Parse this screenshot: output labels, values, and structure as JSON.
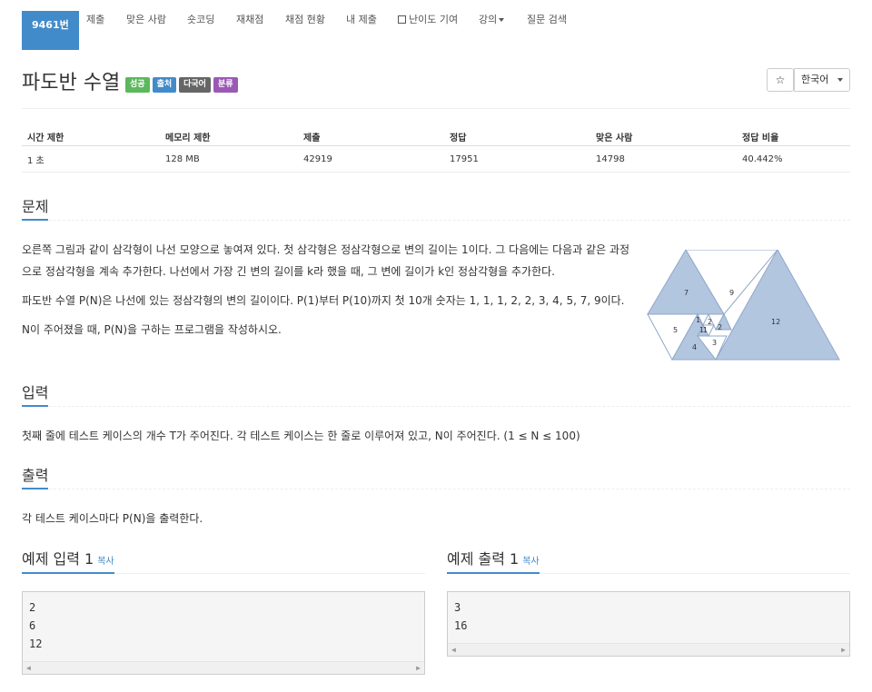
{
  "nav": {
    "items": [
      "9461번",
      "제출",
      "맞은 사람",
      "숏코딩",
      "재채점",
      "채점 현황",
      "내 제출",
      "난이도 기여",
      "강의",
      "질문 검색"
    ]
  },
  "problem": {
    "title": "파도반 수열",
    "badges": [
      {
        "label": "성공",
        "color": "#5cb85c"
      },
      {
        "label": "출처",
        "color": "#428bca"
      },
      {
        "label": "다국어",
        "color": "#666666"
      },
      {
        "label": "분류",
        "color": "#9b59b6"
      }
    ],
    "star": "☆",
    "language": "한국어"
  },
  "info": {
    "headers": [
      "시간 제한",
      "메모리 제한",
      "제출",
      "정답",
      "맞은 사람",
      "정답 비율"
    ],
    "values": [
      "1 초",
      "128 MB",
      "42919",
      "17951",
      "14798",
      "40.442%"
    ]
  },
  "sections": {
    "problem_heading": "문제",
    "problem_text_1": "오른쪽 그림과 같이 삼각형이 나선 모양으로 놓여져 있다. 첫 삼각형은 정삼각형으로 변의 길이는 1이다. 그 다음에는 다음과 같은 과정으로 정삼각형을 계속 추가한다. 나선에서 가장 긴 변의 길이를 k라 했을 때, 그 변에 길이가 k인 정삼각형을 추가한다.",
    "problem_text_2": "파도반 수열 P(N)은 나선에 있는 정삼각형의 변의 길이이다. P(1)부터 P(10)까지 첫 10개 숫자는 1, 1, 1, 2, 2, 3, 4, 5, 7, 9이다.",
    "problem_text_3": "N이 주어졌을 때, P(N)을 구하는 프로그램을 작성하시오.",
    "input_heading": "입력",
    "input_text": "첫째 줄에 테스트 케이스의 개수 T가 주어진다. 각 테스트 케이스는 한 줄로 이루어져 있고, N이 주어진다. (1 ≤ N ≤ 100)",
    "output_heading": "출력",
    "output_text": "각 테스트 케이스마다 P(N)을 출력한다."
  },
  "figure": {
    "labels": [
      "7",
      "9",
      "12",
      "5",
      "4",
      "3",
      "2",
      "1",
      "1",
      "1",
      "2"
    ],
    "fill": "#b3c6e0",
    "stroke": "#8fa7c8"
  },
  "samples": {
    "input_title": "예제 입력 1",
    "output_title": "예제 출력 1",
    "copy": "복사",
    "input_lines": [
      "2",
      "6",
      "12"
    ],
    "output_lines": [
      "3",
      "16"
    ]
  }
}
